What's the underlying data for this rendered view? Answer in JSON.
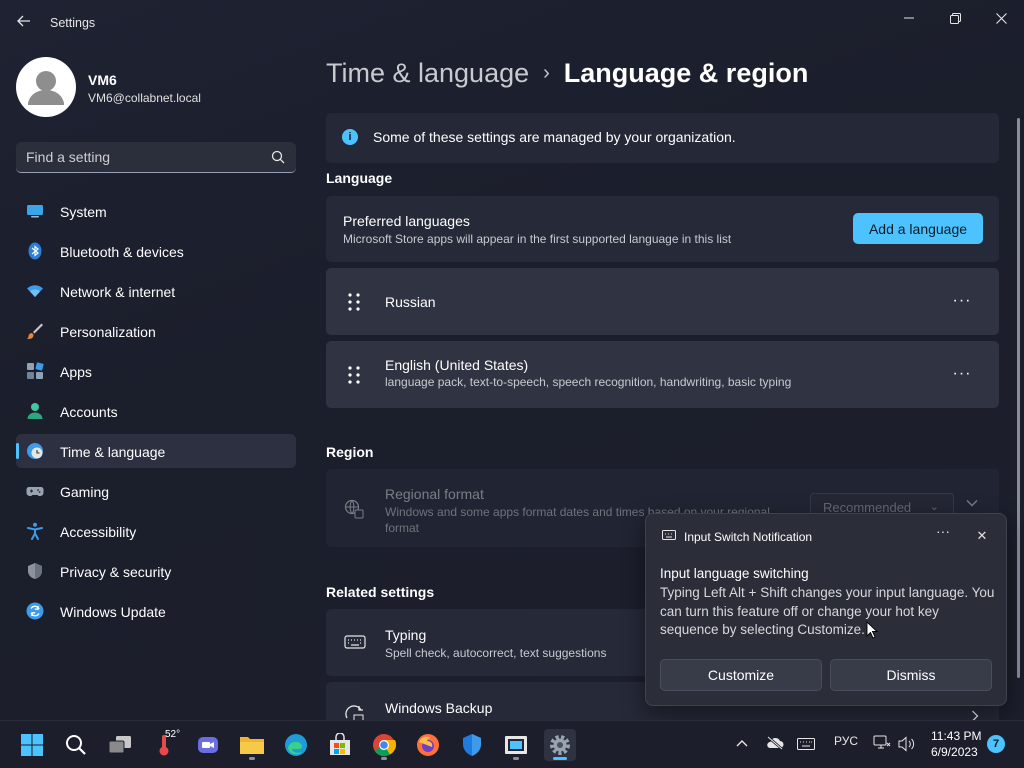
{
  "window": {
    "title": "Settings",
    "controls": {
      "minimize": "—",
      "maximize": "❐",
      "close": "✕"
    }
  },
  "profile": {
    "name": "VM6",
    "email": "VM6@collabnet.local"
  },
  "search": {
    "placeholder": "Find a setting"
  },
  "sidebar": {
    "items": [
      {
        "label": "System",
        "icon": "system-icon"
      },
      {
        "label": "Bluetooth & devices",
        "icon": "bluetooth-icon"
      },
      {
        "label": "Network & internet",
        "icon": "wifi-icon"
      },
      {
        "label": "Personalization",
        "icon": "brush-icon"
      },
      {
        "label": "Apps",
        "icon": "apps-icon"
      },
      {
        "label": "Accounts",
        "icon": "accounts-icon"
      },
      {
        "label": "Time & language",
        "icon": "time-language-icon",
        "active": true
      },
      {
        "label": "Gaming",
        "icon": "gamepad-icon"
      },
      {
        "label": "Accessibility",
        "icon": "accessibility-icon"
      },
      {
        "label": "Privacy & security",
        "icon": "shield-icon"
      },
      {
        "label": "Windows Update",
        "icon": "update-icon"
      }
    ]
  },
  "breadcrumb": {
    "parent": "Time & language",
    "separator": "›",
    "current": "Language & region"
  },
  "info_bar": {
    "text": "Some of these settings are managed by your organization."
  },
  "language_section": {
    "title": "Language",
    "preferred": {
      "title": "Preferred languages",
      "subtitle": "Microsoft Store apps will appear in the first supported language in this list",
      "add_button": "Add a language"
    },
    "languages": [
      {
        "name": "Russian",
        "detail": ""
      },
      {
        "name": "English (United States)",
        "detail": "language pack, text-to-speech, speech recognition, handwriting, basic typing"
      }
    ],
    "more_glyph": "···"
  },
  "region_section": {
    "title": "Region",
    "regional_format": {
      "title": "Regional format",
      "subtitle": "Windows and some apps format dates and times based on your regional format",
      "dropdown_value": "Recommended"
    }
  },
  "related_section": {
    "title": "Related settings",
    "items": [
      {
        "title": "Typing",
        "subtitle": "Spell check, autocorrect, text suggestions"
      },
      {
        "title": "Windows Backup",
        "subtitle": ""
      }
    ]
  },
  "toast": {
    "app_name": "Input Switch Notification",
    "title": "Input language switching",
    "body": "Typing Left Alt + Shift changes your input language. You can turn this feature off or change your hot key sequence by selecting Customize.",
    "customize_label": "Customize",
    "dismiss_label": "Dismiss",
    "more_glyph": "···",
    "close_glyph": "✕"
  },
  "taskbar": {
    "weather_temp": "52°",
    "input_language": "РУС",
    "time": "11:43 PM",
    "date": "6/9/2023",
    "notification_count": "7"
  },
  "colors": {
    "accent": "#4cc2ff",
    "background": "#1c1f2c",
    "card": "#2a2d3a"
  }
}
